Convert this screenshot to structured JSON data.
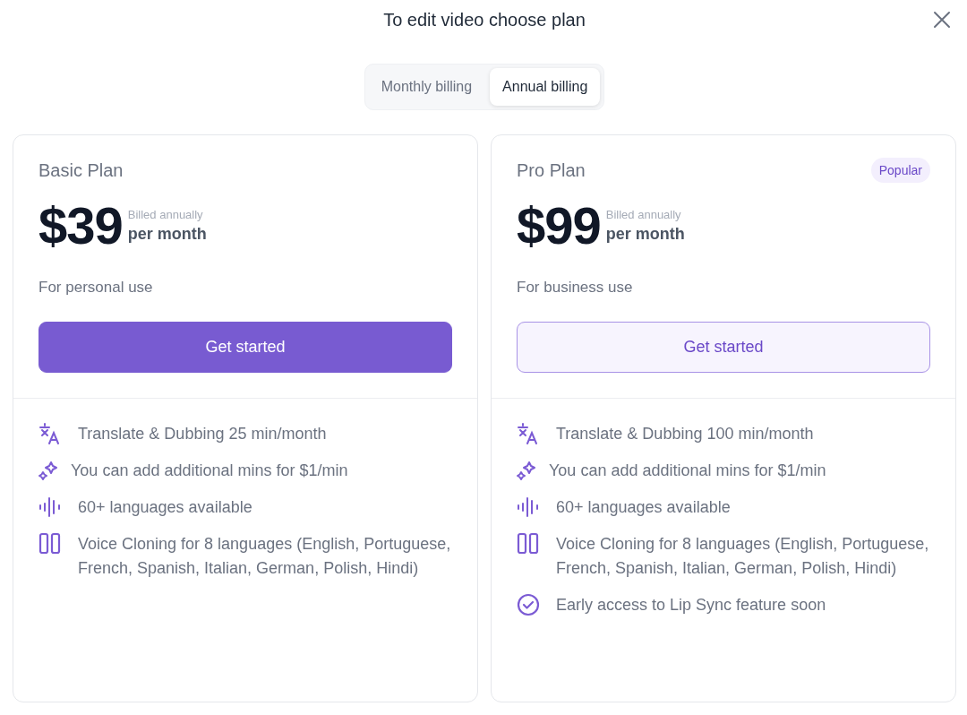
{
  "title": "To edit video choose plan",
  "billing_tabs": [
    {
      "label": "Monthly billing",
      "selected": false
    },
    {
      "label": "Annual billing",
      "selected": true
    }
  ],
  "plans": [
    {
      "name": "Basic Plan",
      "price": "$39",
      "billed": "Billed annually",
      "period": "per month",
      "description": "For personal use",
      "button": {
        "label": "Get started",
        "primary": true
      },
      "features": [
        {
          "kind": "translate",
          "text": "Translate & Dubbing 25 min/month"
        },
        {
          "kind": "sparkles",
          "text": "You can add additional mins for $1/min"
        },
        {
          "kind": "waveform",
          "text": "60+ languages available"
        },
        {
          "kind": "columns",
          "text": "Voice Cloning for 8 languages (English, Portuguese, French, Spanish, Italian, German, Polish, Hindi)"
        }
      ]
    },
    {
      "name": "Pro Plan",
      "badge": "Popular",
      "price": "$99",
      "billed": "Billed annually",
      "period": "per month",
      "description": "For business use",
      "button": {
        "label": "Get started",
        "primary": false
      },
      "features": [
        {
          "kind": "translate",
          "text": "Translate & Dubbing 100 min/month"
        },
        {
          "kind": "sparkles",
          "text": "You can add additional mins for $1/min"
        },
        {
          "kind": "waveform",
          "text": "60+ languages available"
        },
        {
          "kind": "columns",
          "text": "Voice Cloning for 8 languages (English, Portuguese, French, Spanish, Italian, German, Polish, Hindi)"
        },
        {
          "kind": "check",
          "text": "Early access to Lip Sync feature soon"
        }
      ]
    }
  ]
}
